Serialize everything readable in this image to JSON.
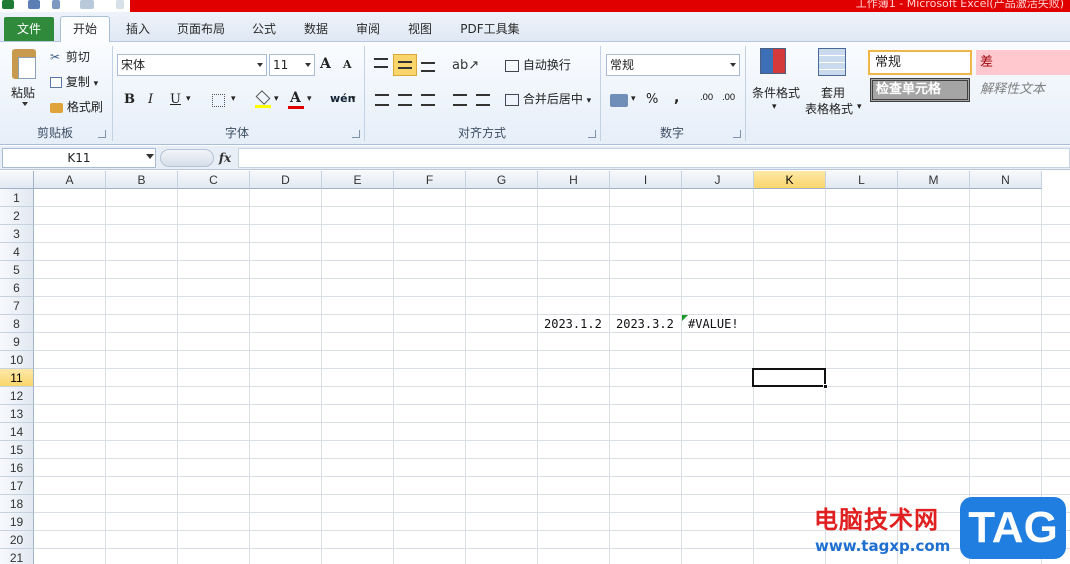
{
  "window": {
    "title": "工作簿1 - Microsoft Excel(产品激活失败)"
  },
  "tabs": [
    {
      "label": "文件"
    },
    {
      "label": "开始"
    },
    {
      "label": "插入"
    },
    {
      "label": "页面布局"
    },
    {
      "label": "公式"
    },
    {
      "label": "数据"
    },
    {
      "label": "审阅"
    },
    {
      "label": "视图"
    },
    {
      "label": "PDF工具集"
    }
  ],
  "ribbon": {
    "clipboard": {
      "group": "剪贴板",
      "paste": "粘贴",
      "cut": "剪切",
      "copy": "复制",
      "format_painter": "格式刷"
    },
    "font": {
      "group": "字体",
      "name": "宋体",
      "size": "11",
      "grow": "A",
      "shrink": "A",
      "bold": "B",
      "italic": "I",
      "underline": "U",
      "font_color_letter": "A",
      "phonetic": "wén"
    },
    "alignment": {
      "group": "对齐方式",
      "wrap": "自动换行",
      "merge": "合并后居中"
    },
    "number": {
      "group": "数字",
      "format": "常规",
      "percent": "%",
      "comma": ",",
      "inc_dec": ".00",
      "dec_dec": ".00"
    },
    "styles": {
      "conditional": "条件格式",
      "table_line1": "套用",
      "table_line2": "表格格式",
      "style_normal": "常规",
      "style_bad": "差",
      "style_check": "检查单元格",
      "style_explain": "解释性文本"
    }
  },
  "formula_bar": {
    "name_box": "K11",
    "fx": "fx",
    "value": ""
  },
  "sheet": {
    "columns": [
      "A",
      "B",
      "C",
      "D",
      "E",
      "F",
      "G",
      "H",
      "I",
      "J",
      "K",
      "L",
      "M",
      "N"
    ],
    "rows": [
      "1",
      "2",
      "3",
      "4",
      "5",
      "6",
      "7",
      "8",
      "9",
      "10",
      "11",
      "12",
      "13",
      "14",
      "15",
      "16",
      "17",
      "18",
      "19",
      "20",
      "21"
    ],
    "selected_column": "K",
    "selected_row": "11",
    "cells": [
      {
        "ref": "H8",
        "text": "2023.1.2"
      },
      {
        "ref": "I8",
        "text": "2023.3.2"
      },
      {
        "ref": "J8",
        "text": "#VALUE!"
      }
    ]
  },
  "watermark": {
    "text": "电脑技术网",
    "url": "www.tagxp.com",
    "badge": "TAG"
  }
}
